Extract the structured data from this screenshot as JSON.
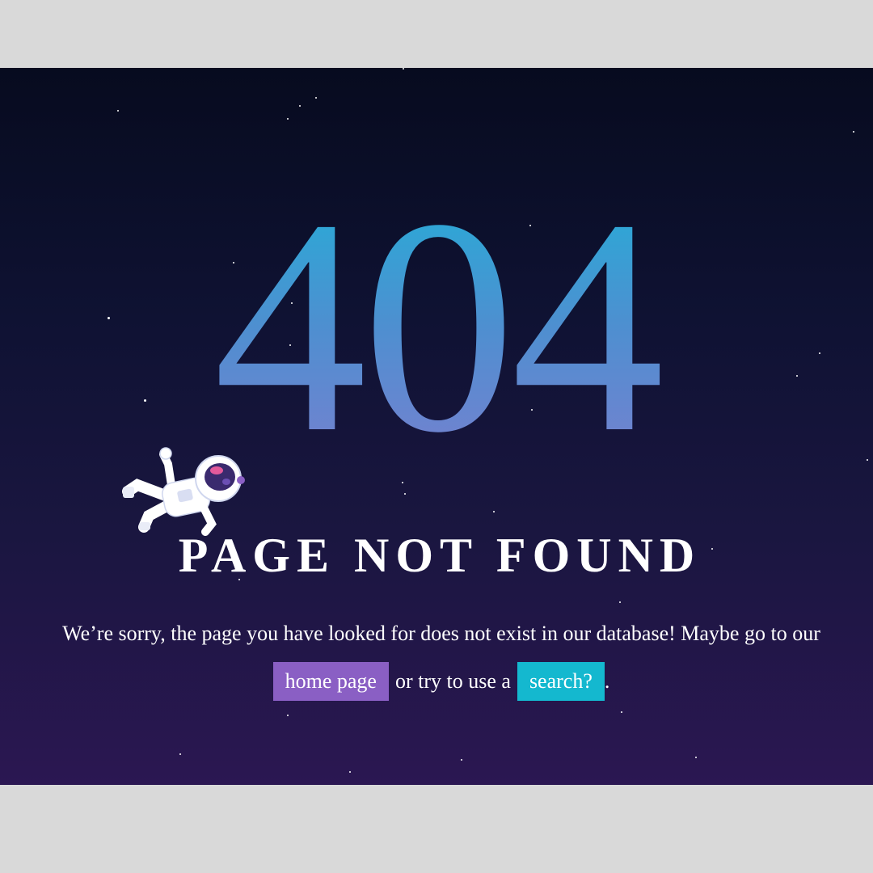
{
  "error": {
    "code": "404",
    "title": "PAGE NOT FOUND",
    "message_line1": "We’re sorry, the page you have looked for does not exist in our database! Maybe go to our",
    "middle_text": "or try to use a",
    "trailing_text": ".",
    "home_link": "home page",
    "search_link": "search?"
  },
  "illustration": {
    "astronaut": "astronaut-icon"
  },
  "colors": {
    "background_top": "#070b1f",
    "background_bottom": "#2b1752",
    "code_gradient_top": "#21b0d8",
    "code_gradient_bottom": "#7a7fcf",
    "home_button": "#8a5fc4",
    "search_button": "#14b8cf",
    "text": "#ffffff",
    "outer_background": "#d9d9d9"
  }
}
